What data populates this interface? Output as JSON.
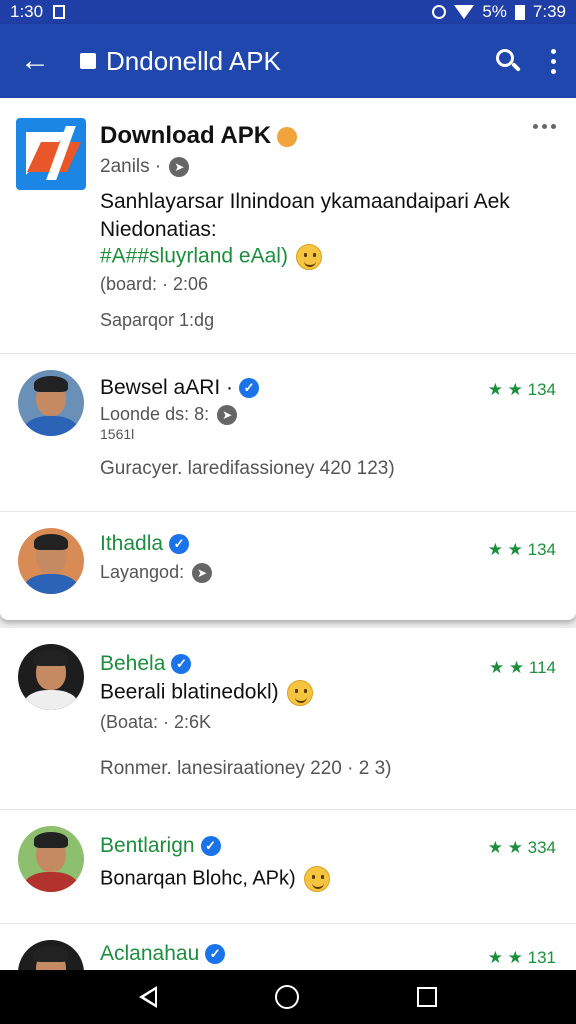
{
  "status_bar": {
    "time_left": "1:30",
    "battery": "5%",
    "time_right": "7:39"
  },
  "app_bar": {
    "title": "Dndonelld APK"
  },
  "featured": {
    "title": "Download APK",
    "meta": "2anils ·",
    "desc_line1": "Sanhlayarsar Ilnindoan ykamaandaipari Aek",
    "desc_line2": "Niedonatias:",
    "hashtag": "#A##sluyrland eAal)",
    "stat": "(board: · 2:06",
    "footer": "Saparqor 1:dg"
  },
  "items": [
    {
      "name": "Bewsel aARI ·",
      "sub": "Loonde ds: 8:",
      "sub2": "1561l",
      "body": "Guracyer. laredifassioney 420 123)",
      "stars": "★ ★ 134"
    },
    {
      "name": "Ithadla",
      "sub": "Layangod:",
      "stars": "★ ★ 134"
    },
    {
      "name": "Behela",
      "sub": "Beerali blatinedokl)",
      "stat": "(Boata: · 2:6K",
      "body": "Ronmer. lanesiraationey 220 · 2 3)",
      "stars": "★ ★ 114"
    },
    {
      "name": "Bentlarign",
      "sub": "Bonarqan Blohc, APk)",
      "stars": "★ ★ 334"
    },
    {
      "name": "Aclanahau",
      "stars": "★ ★ 131"
    }
  ]
}
